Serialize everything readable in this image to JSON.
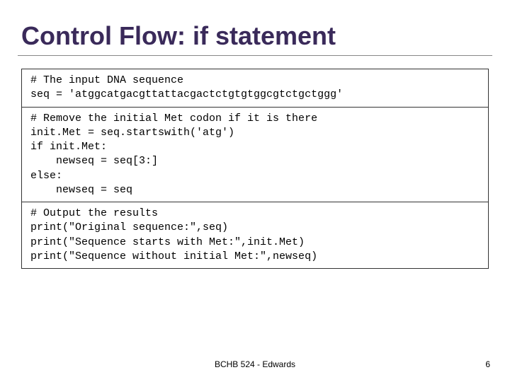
{
  "title": "Control Flow: if statement",
  "code": {
    "s1_l1": "# The input DNA sequence",
    "s1_l2": "seq = 'atggcatgacgttattacgactctgtgtggcgtctgctggg'",
    "s2_l1": "# Remove the initial Met codon if it is there",
    "s2_l2": "init.Met = seq.startswith('atg')",
    "s2_l3": "if init.Met:",
    "s2_l4": "newseq = seq[3:]",
    "s2_l5": "else:",
    "s2_l6": "newseq = seq",
    "s3_l1": "# Output the results",
    "s3_l2": "print(\"Original sequence:\",seq)",
    "s3_l3": "print(\"Sequence starts with Met:\",init.Met)",
    "s3_l4": "print(\"Sequence without initial Met:\",newseq)"
  },
  "footer": "BCHB 524 - Edwards",
  "page": "6"
}
